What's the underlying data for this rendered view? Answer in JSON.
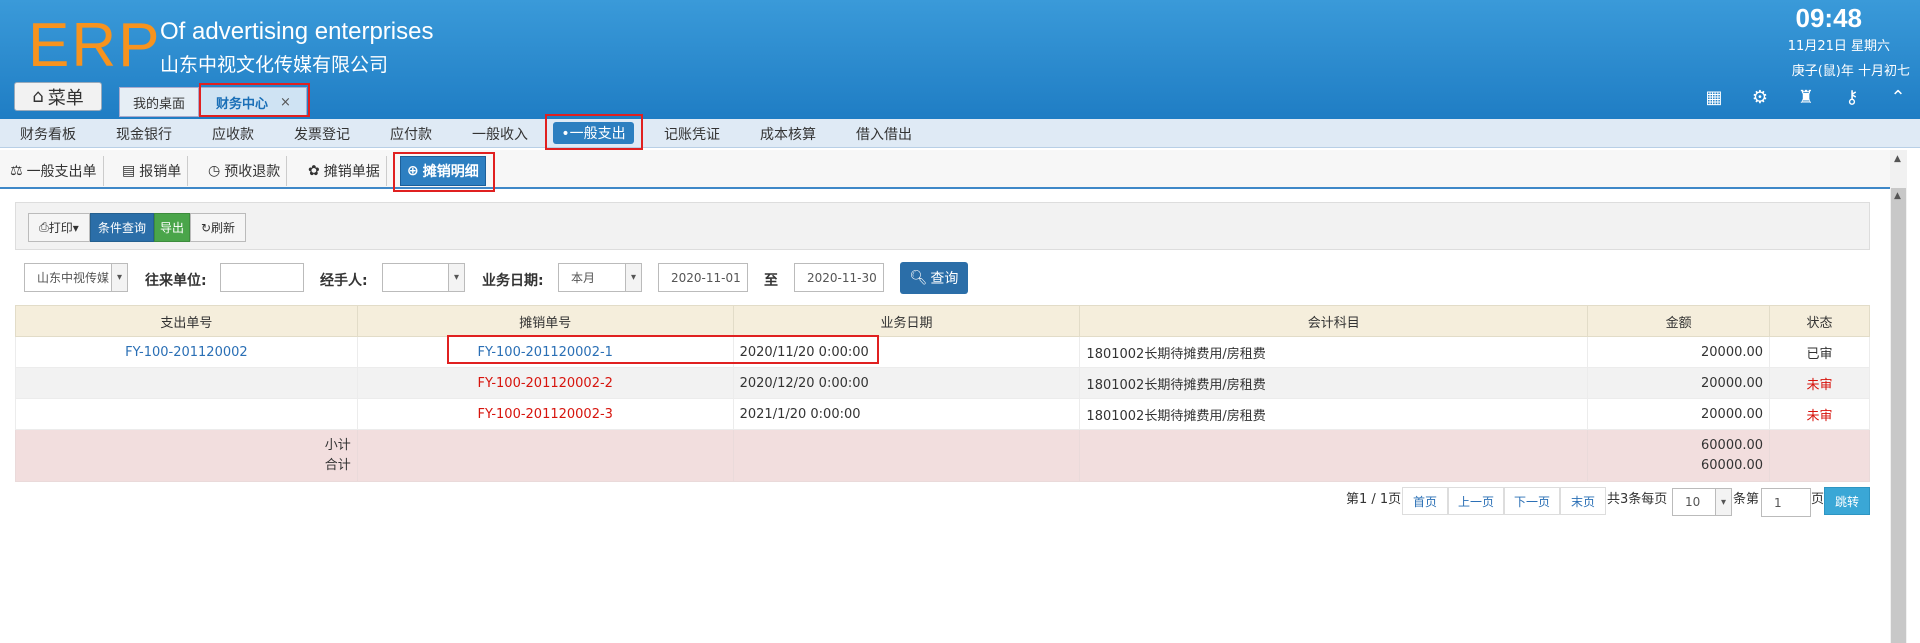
{
  "header": {
    "logo": "ERP",
    "slogan": "Of advertising enterprises",
    "company": "山东中视文化传媒有限公司",
    "time": "09:48",
    "date": "11月21日 星期六",
    "lunar": "庚子(鼠)年 十月初七",
    "icons": [
      "grid-plus-icon",
      "gear-icon",
      "shirt-icon",
      "key-icon",
      "chevron-up-circle-icon"
    ]
  },
  "menu_label": "菜单",
  "tabs": [
    {
      "label": "我的桌面"
    },
    {
      "label": "财务中心",
      "close": "×"
    }
  ],
  "nav": [
    "财务看板",
    "现金银行",
    "应收款",
    "发票登记",
    "应付款",
    "一般收入",
    "•一般支出",
    "记账凭证",
    "成本核算",
    "借入借出"
  ],
  "subnav": [
    "一般支出单",
    "报销单",
    "预收退款",
    "摊销单据",
    "摊销明细"
  ],
  "toolbar": {
    "print": "打印",
    "query": "条件查询",
    "export": "导出",
    "refresh": "刷新"
  },
  "filters": {
    "company_value": "山东中视传媒",
    "partner_label": "往来单位:",
    "partner_value": "",
    "handler_label": "经手人:",
    "handler_value": "",
    "date_label": "业务日期:",
    "period_value": "本月",
    "start_date": "2020-11-01",
    "to_label": "至",
    "end_date": "2020-11-30",
    "query_button": "查询"
  },
  "table": {
    "headers": [
      "支出单号",
      "摊销单号",
      "业务日期",
      "会计科目",
      "金额",
      "状态"
    ],
    "rows": [
      {
        "expense_no": "FY-100-201120002",
        "amort_no": "FY-100-201120002-1",
        "date": "2020/11/20 0:00:00",
        "subject": "1801002长期待摊费用/房租费",
        "amount": "20000.00",
        "status": "已审"
      },
      {
        "expense_no": "",
        "amort_no": "FY-100-201120002-2",
        "date": "2020/12/20 0:00:00",
        "subject": "1801002长期待摊费用/房租费",
        "amount": "20000.00",
        "status": "未审"
      },
      {
        "expense_no": "",
        "amort_no": "FY-100-201120002-3",
        "date": "2021/1/20 0:00:00",
        "subject": "1801002长期待摊费用/房租费",
        "amount": "20000.00",
        "status": "未审"
      }
    ],
    "subtotal_label": "小计",
    "total_label": "合计",
    "subtotal_amount": "60000.00",
    "total_amount": "60000.00"
  },
  "pagination": {
    "page_info": "第1 / 1页",
    "first": "首页",
    "prev": "上一页",
    "next": "下一页",
    "last": "末页",
    "records_prefix": "共3条每页",
    "per_page": "10",
    "records_suffix": "条第",
    "page_input": "1",
    "page_suffix": "页",
    "go": "跳转"
  },
  "colors": {
    "header_blue": "#1f7dc4",
    "logo_orange": "#f7931e",
    "link_blue": "#2a6fb5",
    "status_red": "#d7140d",
    "highlight_red": "#e02020"
  }
}
